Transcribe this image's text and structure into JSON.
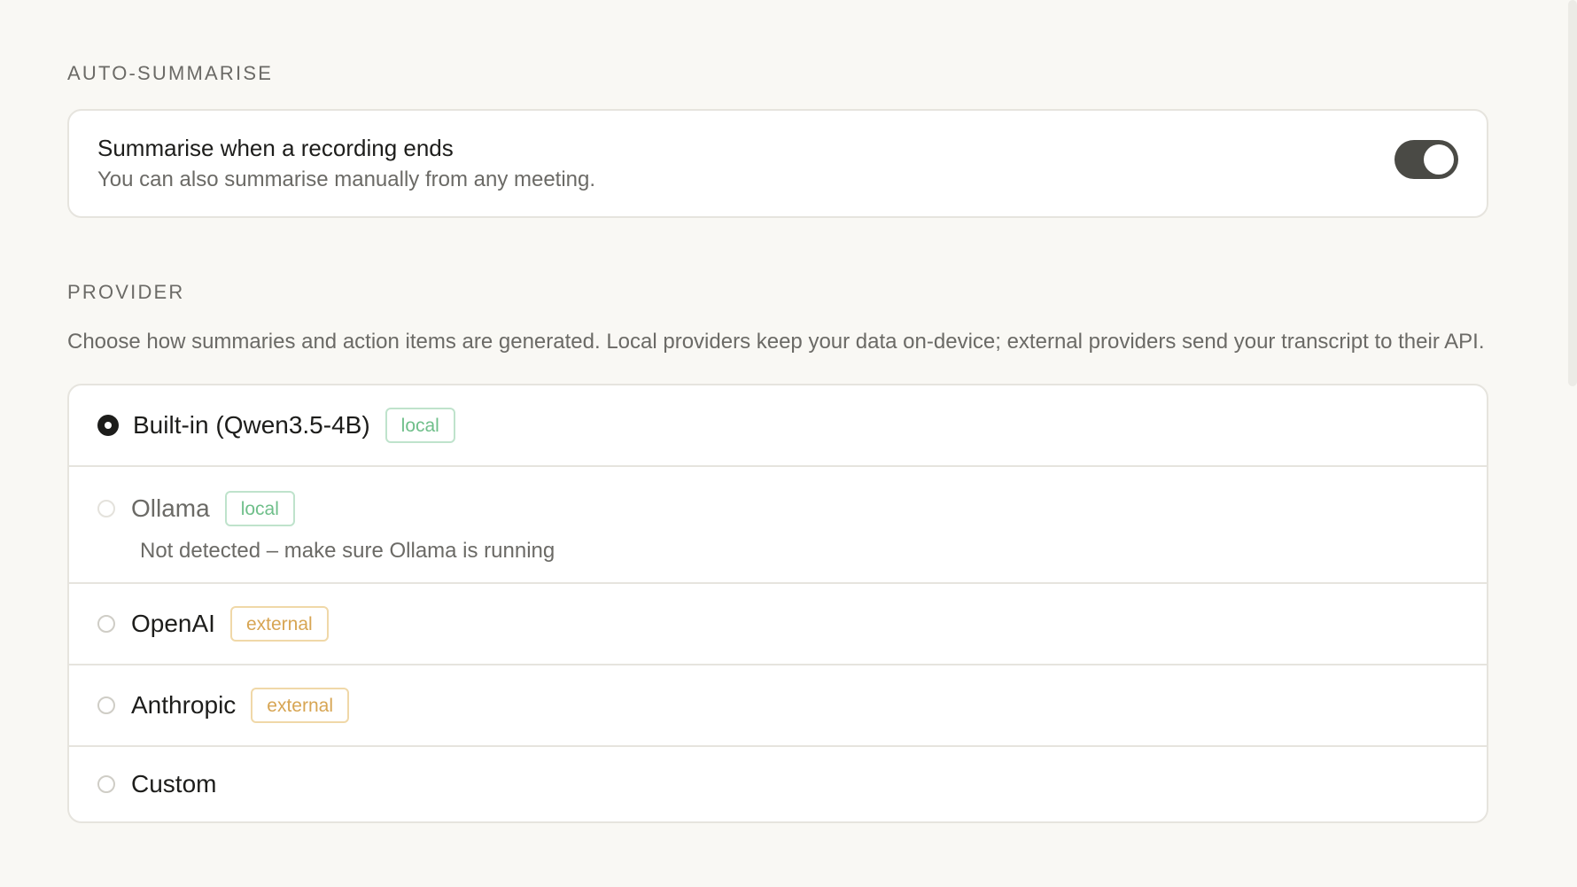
{
  "auto_summarise": {
    "section_label": "AUTO-SUMMARISE",
    "title": "Summarise when a recording ends",
    "subtitle": "You can also summarise manually from any meeting.",
    "enabled": true
  },
  "provider": {
    "section_label": "PROVIDER",
    "description": "Choose how summaries and action items are generated. Local providers keep your data on-device; external providers send your transcript to their API.",
    "selected": "Built-in (Qwen3.5-4B)",
    "options": [
      {
        "name": "Built-in (Qwen3.5-4B)",
        "badge": "local",
        "checked": true,
        "disabled": false,
        "note": ""
      },
      {
        "name": "Ollama",
        "badge": "local",
        "checked": false,
        "disabled": true,
        "note": "Not detected – make sure Ollama is running"
      },
      {
        "name": "OpenAI",
        "badge": "external",
        "checked": false,
        "disabled": false,
        "note": ""
      },
      {
        "name": "Anthropic",
        "badge": "external",
        "checked": false,
        "disabled": false,
        "note": ""
      },
      {
        "name": "Custom",
        "badge": "",
        "checked": false,
        "disabled": false,
        "note": ""
      }
    ]
  },
  "colors": {
    "background": "#f9f8f4",
    "toggle_on": "#4a4a45",
    "local_badge": "#6fbf8a",
    "external_badge": "#d7a553"
  }
}
